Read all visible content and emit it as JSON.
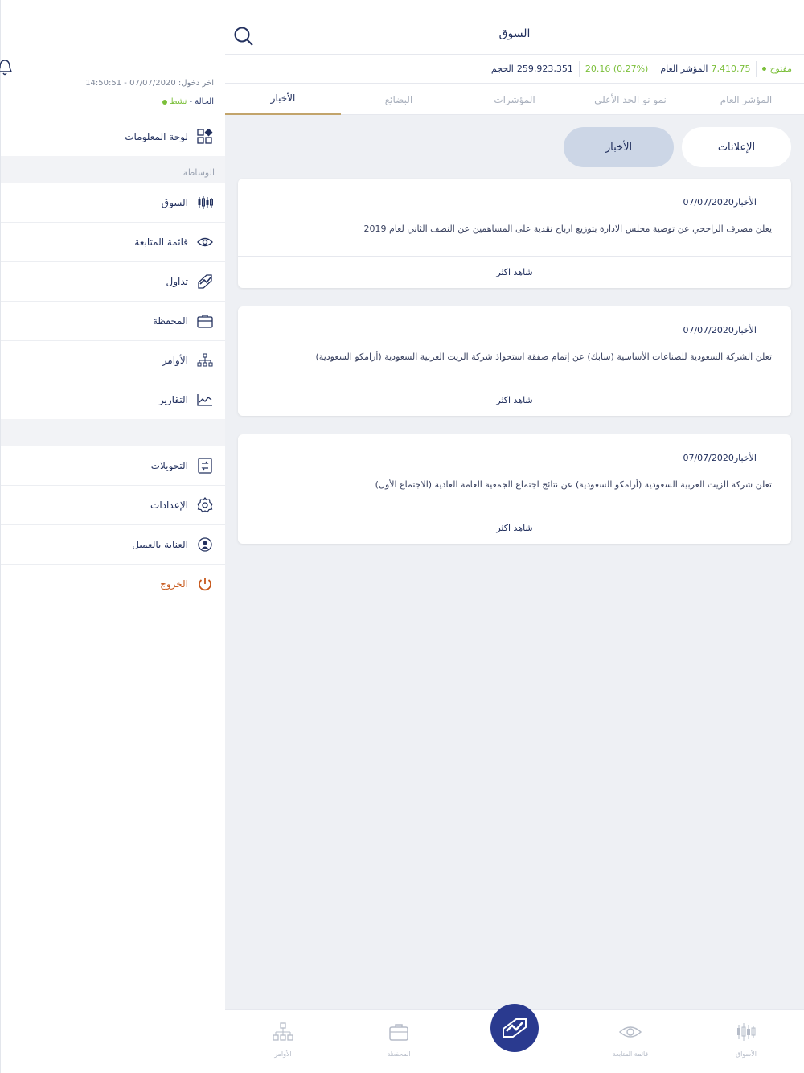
{
  "header": {
    "title": "السوق"
  },
  "ticker": {
    "status": "مفتوح",
    "index_label": "المؤشر العام",
    "index_value": "7,410.75",
    "change": "20.16 (0.27%)",
    "volume_label": "الحجم",
    "volume_value": "259,923,351"
  },
  "tabs": [
    {
      "label": "المؤشر العام"
    },
    {
      "label": "نمو نو الحد الأعلى"
    },
    {
      "label": "المؤشرات"
    },
    {
      "label": "البضائع"
    },
    {
      "label": "الأخبار"
    }
  ],
  "segments": {
    "announcements": "الإعلانات",
    "news": "الأخبار"
  },
  "news": [
    {
      "category": "الأخبار",
      "date": "07/07/2020",
      "headline": "يعلن مصرف الراجحي عن توصية مجلس الادارة بتوزيع ارباح نقدية على المساهمين عن النصف الثاني لعام 2019",
      "more": "شاهد اكثر"
    },
    {
      "category": "الأخبار",
      "date": "07/07/2020",
      "headline": "تعلن الشركة السعودية للصناعات الأساسية (سابك) عن إتمام صفقة استحواذ شركة الزيت العربية السعودية (أرامكو السعودية)",
      "more": "شاهد اكثر"
    },
    {
      "category": "الأخبار",
      "date": "07/07/2020",
      "headline": "تعلن شركة الزيت العربية السعودية (أرامكو السعودية) عن نتائج اجتماع الجمعية العامة العادية (الاجتماع الأول)",
      "more": "شاهد اكثر"
    }
  ],
  "sidebar": {
    "last_login": "اخر دخول: 07/07/2020 - 14:50:51",
    "status_label": "الحالة -",
    "status_value": "نشط",
    "dashboard": "لوحة المعلومات",
    "section_title": "الوساطة",
    "items": [
      {
        "label": "السوق"
      },
      {
        "label": "قائمة المتابعة"
      },
      {
        "label": "تداول"
      },
      {
        "label": "المحفظة"
      },
      {
        "label": "الأوامر"
      },
      {
        "label": "التقارير"
      }
    ],
    "items2": [
      {
        "label": "التحويلات"
      },
      {
        "label": "الإعدادات"
      },
      {
        "label": "العناية بالعميل"
      }
    ],
    "logout": "الخروج"
  },
  "bottom_nav": [
    {
      "label": "الأسواق"
    },
    {
      "label": "قائمة المتابعة"
    },
    {
      "label": "المحفظة"
    },
    {
      "label": "الأوامر"
    }
  ],
  "colors": {
    "navy": "#22305e",
    "gold": "#c2a46b",
    "green": "#7bbf3a",
    "fab": "#2a3a8f",
    "logout": "#c7581b"
  }
}
